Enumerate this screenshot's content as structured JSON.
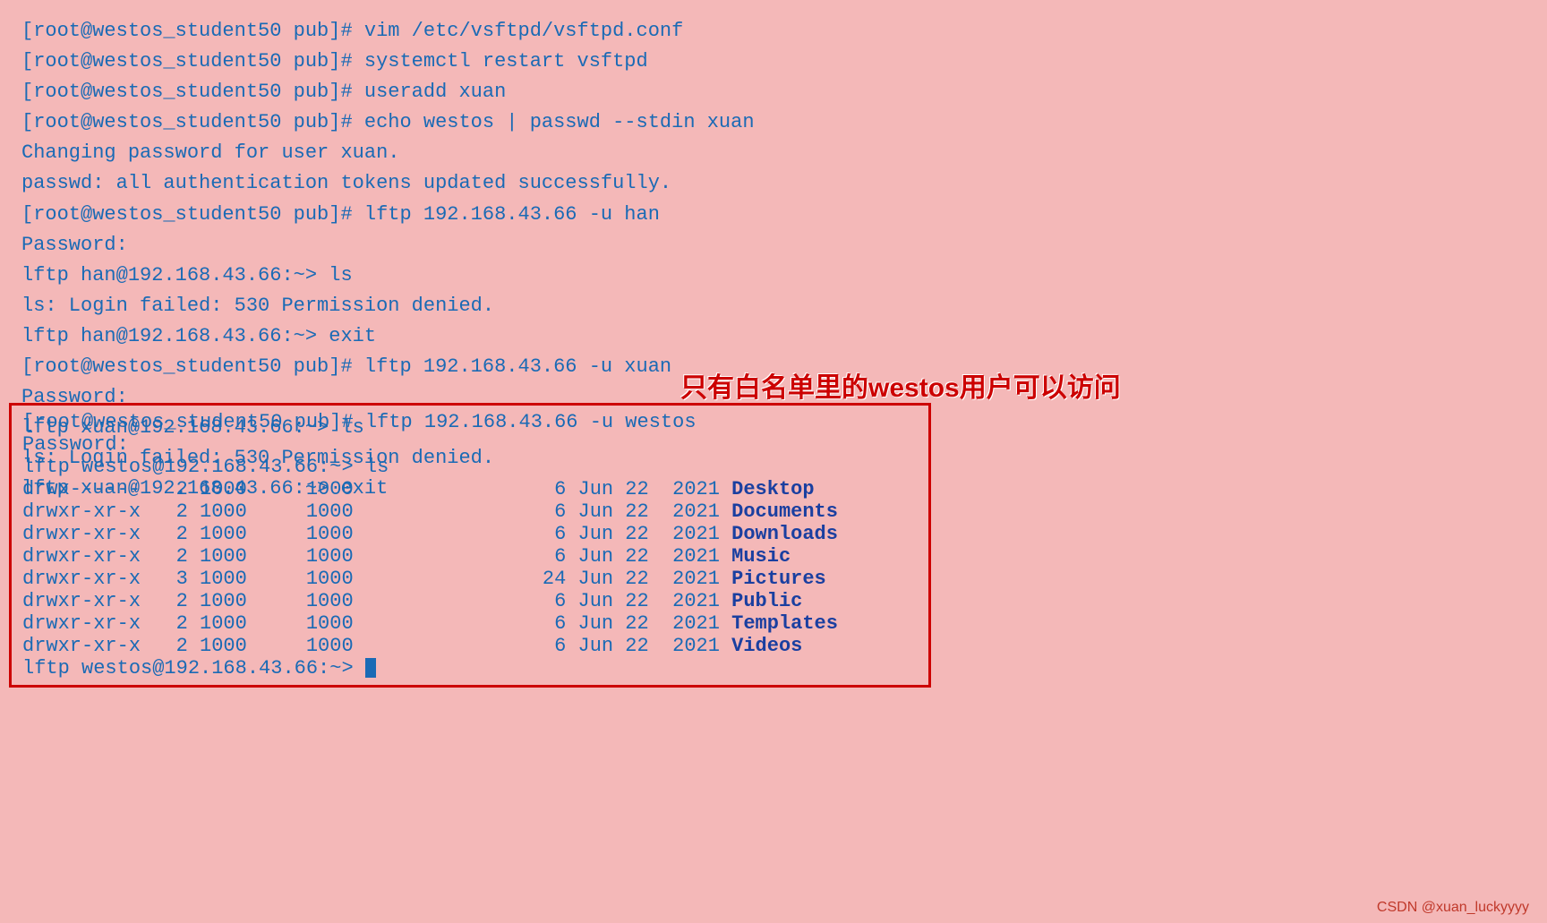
{
  "terminal": {
    "lines": [
      {
        "type": "prompt",
        "text": "[root@westos_student50 pub]# vim /etc/vsftpd/vsftpd.conf"
      },
      {
        "type": "prompt",
        "text": "[root@westos_student50 pub]# systemctl restart vsftpd"
      },
      {
        "type": "prompt",
        "text": "[root@westos_student50 pub]# useradd xuan"
      },
      {
        "type": "prompt",
        "text": "[root@westos_student50 pub]# echo westos | passwd --stdin xuan"
      },
      {
        "type": "output",
        "text": "Changing password for user xuan."
      },
      {
        "type": "output",
        "text": "passwd: all authentication tokens updated successfully."
      },
      {
        "type": "prompt",
        "text": "[root@westos_student50 pub]# lftp 192.168.43.66 -u han"
      },
      {
        "type": "output",
        "text": "Password:"
      },
      {
        "type": "output",
        "text": "lftp han@192.168.43.66:~> ls"
      },
      {
        "type": "output",
        "text": "ls: Login failed: 530 Permission denied."
      },
      {
        "type": "output",
        "text": "lftp han@192.168.43.66:~> exit"
      },
      {
        "type": "prompt",
        "text": "[root@westos_student50 pub]# lftp 192.168.43.66 -u xuan"
      },
      {
        "type": "output",
        "text": "Password:"
      },
      {
        "type": "output",
        "text": "lftp xuan@192.168.43.66:~> ls"
      },
      {
        "type": "output",
        "text": "ls: Login failed: 530 Permission denied."
      },
      {
        "type": "output",
        "text": "lftp xuan@192.168.43.66:~> exit"
      }
    ],
    "highlighted": [
      {
        "type": "prompt",
        "text": "[root@westos_student50 pub]# lftp 192.168.43.66 -u westos"
      },
      {
        "type": "output",
        "text": "Password:"
      },
      {
        "type": "output",
        "text": "lftp westos@192.168.43.66:~> ls"
      },
      {
        "type": "dir",
        "perms": "drwx------",
        "links": "2",
        "uid": "1000",
        "gid": "1000",
        "size": "",
        "month": "Jun",
        "day": "22",
        "year": "2021",
        "name": "Desktop"
      },
      {
        "type": "dir",
        "perms": "drwxr-xr-x",
        "links": "2",
        "uid": "1000",
        "gid": "1000",
        "size": "",
        "month": "Jun",
        "day": "22",
        "year": "2021",
        "name": "Documents"
      },
      {
        "type": "dir",
        "perms": "drwxr-xr-x",
        "links": "2",
        "uid": "1000",
        "gid": "1000",
        "size": "",
        "month": "Jun",
        "day": "22",
        "year": "2021",
        "name": "Downloads"
      },
      {
        "type": "dir",
        "perms": "drwxr-xr-x",
        "links": "2",
        "uid": "1000",
        "gid": "1000",
        "size": "",
        "month": "Jun",
        "day": "22",
        "year": "2021",
        "name": "Music"
      },
      {
        "type": "dir",
        "perms": "drwxr-xr-x",
        "links": "3",
        "uid": "1000",
        "gid": "1000",
        "size": "24",
        "month": "Jun",
        "day": "22",
        "year": "2021",
        "name": "Pictures"
      },
      {
        "type": "dir",
        "perms": "drwxr-xr-x",
        "links": "2",
        "uid": "1000",
        "gid": "1000",
        "size": "",
        "month": "Jun",
        "day": "22",
        "year": "2021",
        "name": "Public"
      },
      {
        "type": "dir",
        "perms": "drwxr-xr-x",
        "links": "2",
        "uid": "1000",
        "gid": "1000",
        "size": "",
        "month": "Jun",
        "day": "22",
        "year": "2021",
        "name": "Templates"
      },
      {
        "type": "dir",
        "perms": "drwxr-xr-x",
        "links": "2",
        "uid": "1000",
        "gid": "1000",
        "size": "",
        "month": "Jun",
        "day": "22",
        "year": "2021",
        "name": "Videos"
      },
      {
        "type": "prompt_end",
        "text": "lftp westos@192.168.43.66:~> "
      }
    ],
    "annotation": "只有白名单里的westos用户可以访问",
    "watermark": "CSDN @xuan_luckyyyy"
  }
}
